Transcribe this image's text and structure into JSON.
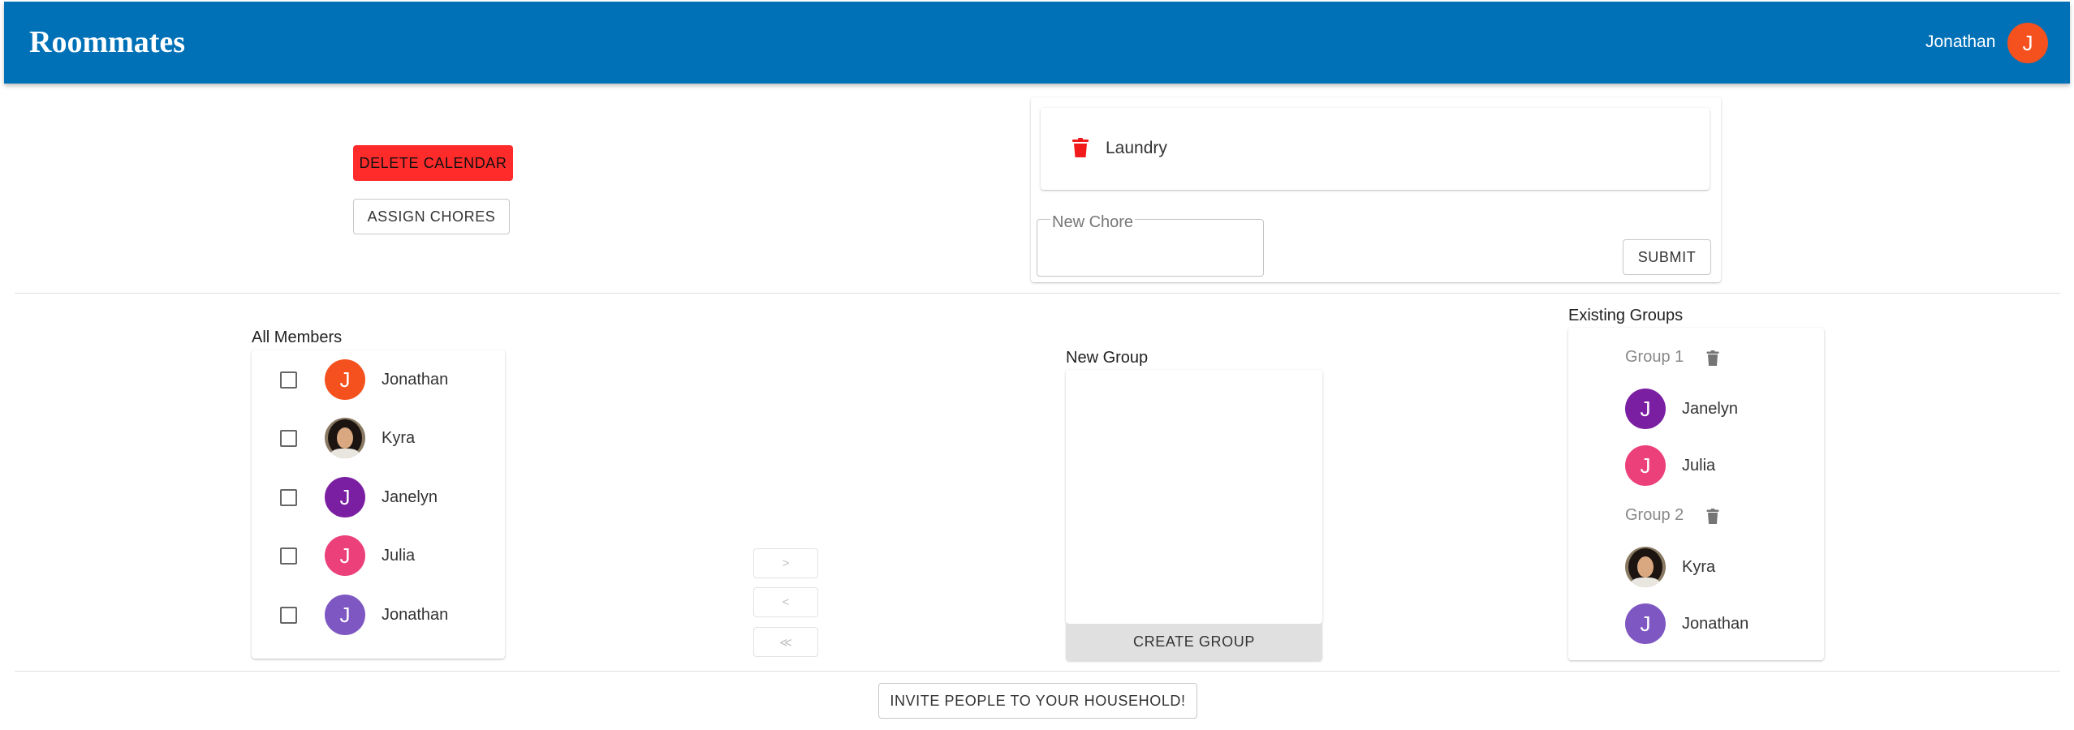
{
  "header": {
    "title": "Roommates",
    "user_name": "Jonathan",
    "user_initial": "J",
    "bar_color": "#0071b7",
    "avatar_color": "#f4511e"
  },
  "calendar_actions": {
    "delete_label": "DELETE CALENDAR",
    "assign_label": "ASSIGN CHORES"
  },
  "chores": {
    "items": [
      {
        "label": "Laundry",
        "icon": "trash-icon"
      }
    ],
    "new_chore_label": "New Chore",
    "new_chore_value": "",
    "submit_label": "SUBMIT"
  },
  "members": {
    "title": "All Members",
    "items": [
      {
        "name": "Jonathan",
        "initial": "J",
        "color": "#f4511e",
        "checked": false
      },
      {
        "name": "Kyra",
        "initial": "",
        "photo": true,
        "checked": false
      },
      {
        "name": "Janelyn",
        "initial": "J",
        "color": "#7b1fa2",
        "checked": false
      },
      {
        "name": "Julia",
        "initial": "J",
        "color": "#ec407a",
        "checked": false
      },
      {
        "name": "Jonathan",
        "initial": "J",
        "color": "#7e57c2",
        "checked": false
      }
    ]
  },
  "transfer": {
    "move_right": ">",
    "move_left": "<",
    "move_all_left": "≪"
  },
  "new_group": {
    "title": "New Group",
    "create_label": "CREATE GROUP"
  },
  "existing_groups": {
    "title": "Existing Groups",
    "groups": [
      {
        "name": "Group 1",
        "members": [
          {
            "name": "Janelyn",
            "initial": "J",
            "color": "#7b1fa2"
          },
          {
            "name": "Julia",
            "initial": "J",
            "color": "#ec407a"
          }
        ]
      },
      {
        "name": "Group 2",
        "members": [
          {
            "name": "Kyra",
            "initial": "",
            "photo": true
          },
          {
            "name": "Jonathan",
            "initial": "J",
            "color": "#7e57c2"
          }
        ]
      }
    ]
  },
  "footer": {
    "invite_label": "INVITE PEOPLE TO YOUR HOUSEHOLD!"
  },
  "colors": {
    "delete_red": "#ff2a2a",
    "trash_red": "#f21b1b",
    "trash_grey": "#757575"
  }
}
